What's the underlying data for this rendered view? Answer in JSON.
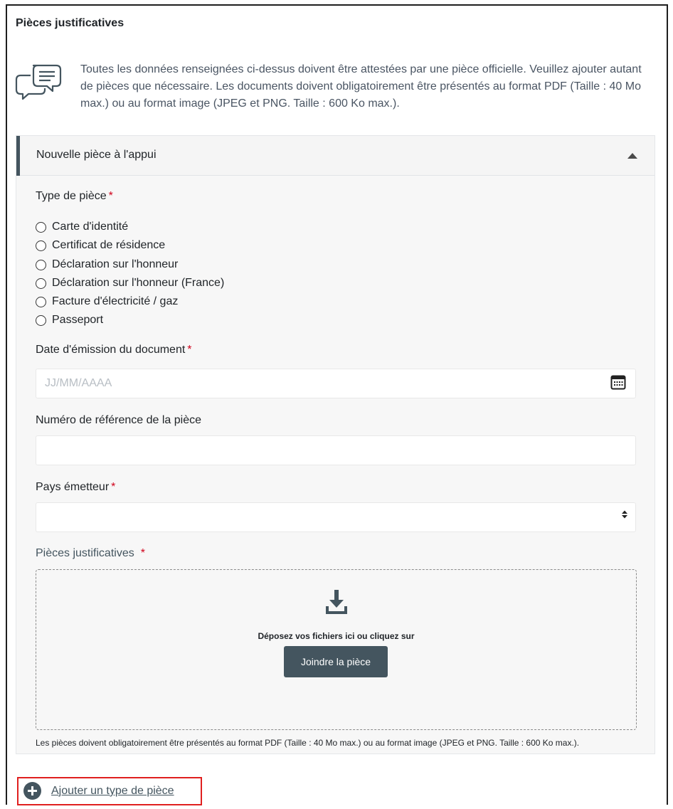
{
  "section": {
    "title": "Pièces justificatives",
    "info_text": "Toutes les données renseignées ci-dessus doivent être attestées par une pièce officielle. Veuillez ajouter autant de pièces que nécessaire. Les documents doivent obligatoirement être présentés au format PDF (Taille : 40 Mo max.) ou au format image (JPEG et PNG. Taille : 600 Ko max.).",
    "info_icon": "chat-bubbles-icon"
  },
  "panel": {
    "title": "Nouvelle pièce à l'appui",
    "collapse_icon": "caret-up-icon",
    "type_label": "Type de pièce",
    "required_mark": "*",
    "type_options": [
      "Carte d'identité",
      "Certificat de résidence",
      "Déclaration sur l'honneur",
      "Déclaration sur l'honneur (France)",
      "Facture d'électricité / gaz",
      "Passeport"
    ],
    "date_label": "Date d'émission du document",
    "date_placeholder": "JJ/MM/AAAA",
    "date_value": "",
    "date_icon": "calendar-icon",
    "reference_label": "Numéro de référence de la pièce",
    "reference_value": "",
    "country_label": "Pays émetteur",
    "country_value": "",
    "country_icon": "select-arrows-icon",
    "attachments_label": "Pièces justificatives",
    "dropzone_icon": "download-icon",
    "dropzone_text": "Déposez vos fichiers ici ou cliquez sur",
    "attach_button": "Joindre la pièce",
    "note": "Les pièces doivent obligatoirement être présentés au format PDF (Taille : 40 Mo max.) ou au format image (JPEG et PNG. Taille : 600 Ko max.)."
  },
  "add_type": {
    "label": "Ajouter un type de pièce",
    "icon": "plus-circle-icon"
  },
  "colors": {
    "accent": "#44555f",
    "required": "#d0021b",
    "highlight": "#e0201f",
    "panel_bg": "#f7f7f7"
  }
}
